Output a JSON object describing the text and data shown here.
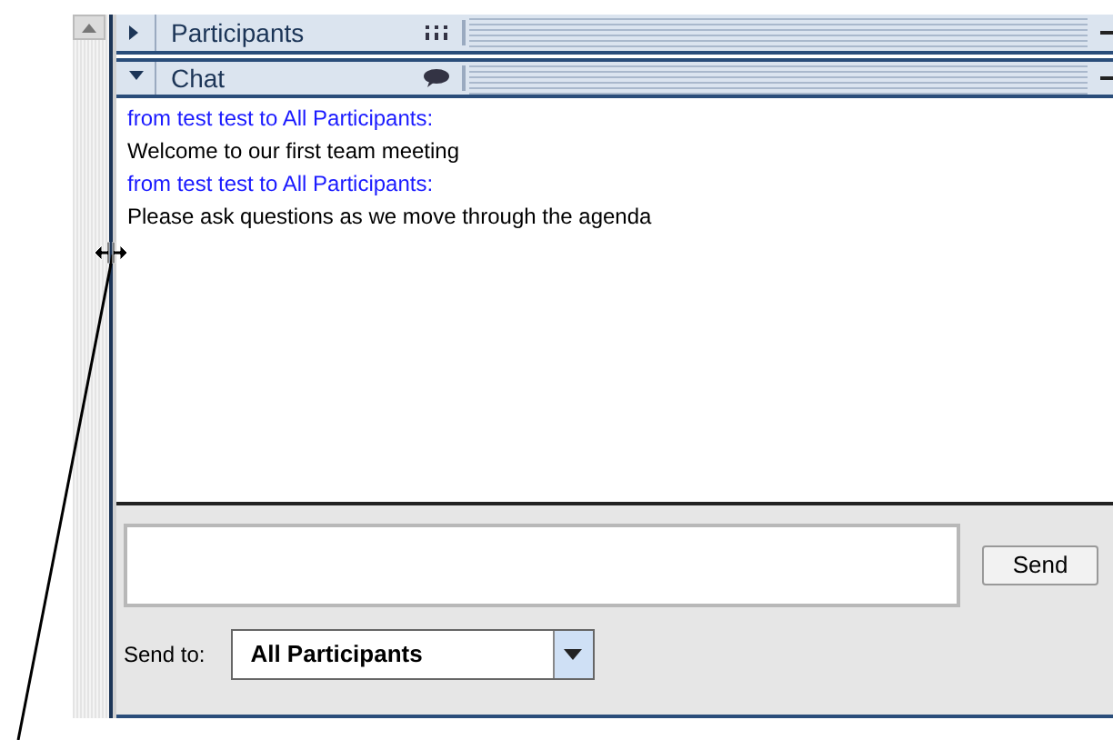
{
  "panels": [
    {
      "title": "Participants",
      "expanded": false
    },
    {
      "title": "Chat",
      "expanded": true
    }
  ],
  "messages": [
    {
      "kind": "header",
      "text": "from test test to All Participants:"
    },
    {
      "kind": "body",
      "text": "Welcome to our first team meeting"
    },
    {
      "kind": "header",
      "text": "from test test to All Participants:"
    },
    {
      "kind": "body",
      "text": "Please ask questions as we move through the agenda"
    }
  ],
  "send_button": "Send",
  "send_to": {
    "label": "Send to:",
    "value": "All Participants"
  }
}
